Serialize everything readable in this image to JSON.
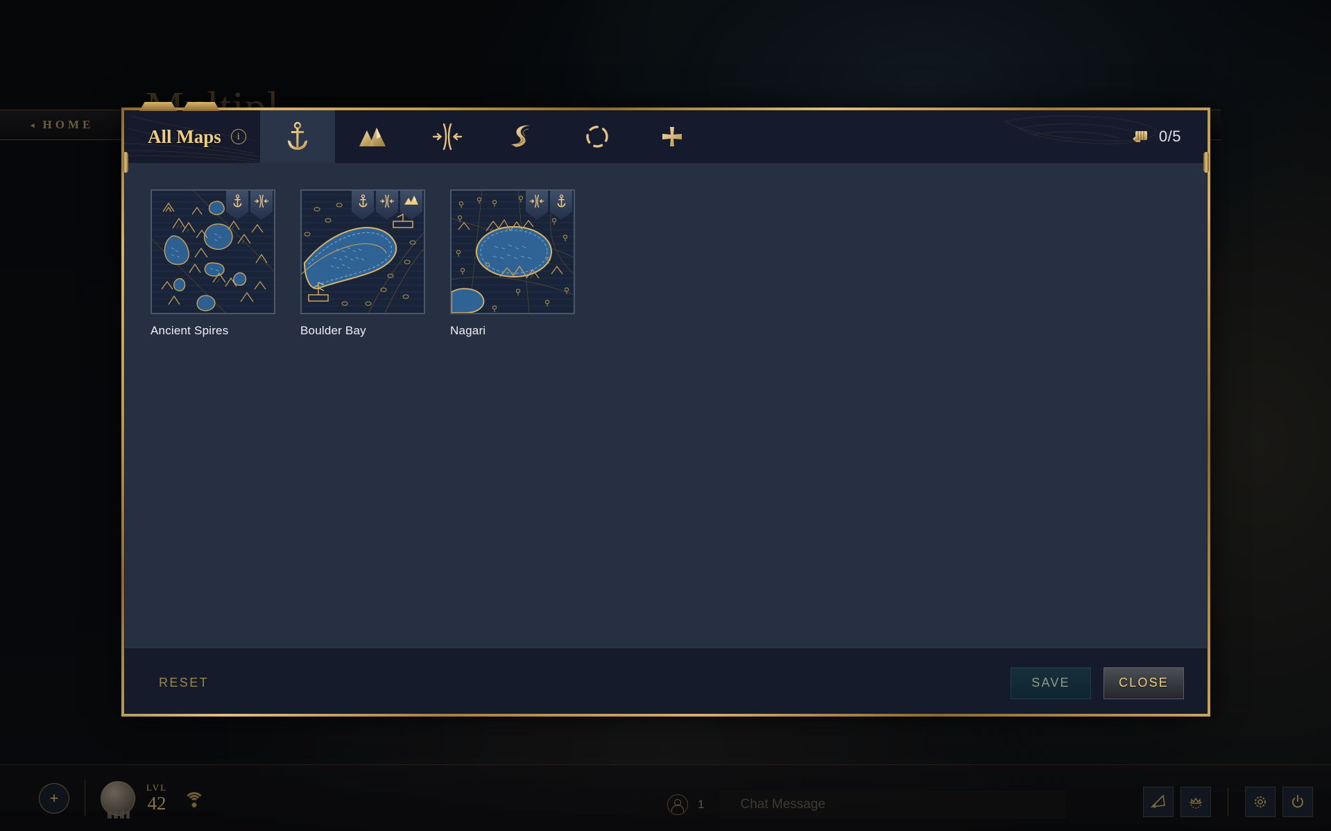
{
  "background": {
    "breadcrumb_home": "HOME",
    "breadcrumb_caret": "◂",
    "page_title": "Multipl"
  },
  "modal": {
    "header": {
      "title": "All Maps",
      "info_icon": "info-icon",
      "counter": {
        "value": "0/5",
        "icon": "fist-icon"
      },
      "tabs": [
        {
          "id": "anchor",
          "icon": "anchor-icon",
          "active": true
        },
        {
          "id": "mountains",
          "icon": "mountains-icon",
          "active": false
        },
        {
          "id": "narrows",
          "icon": "narrows-icon",
          "active": false
        },
        {
          "id": "current",
          "icon": "current-swoosh-icon",
          "active": false
        },
        {
          "id": "ring",
          "icon": "dashed-ring-icon",
          "active": false
        },
        {
          "id": "add",
          "icon": "plus-icon",
          "active": false
        }
      ]
    },
    "maps": [
      {
        "name": "Ancient Spires",
        "badges": [
          "anchor-icon",
          "narrows-icon"
        ]
      },
      {
        "name": "Boulder Bay",
        "badges": [
          "anchor-icon",
          "narrows-icon",
          "mountains-icon"
        ]
      },
      {
        "name": "Nagari",
        "badges": [
          "narrows-icon",
          "anchor-icon"
        ]
      }
    ],
    "footer": {
      "reset_label": "RESET",
      "save_label": "SAVE",
      "close_label": "CLOSE"
    }
  },
  "hud": {
    "add_label": "+",
    "level_label": "LVL",
    "level_value": "42",
    "friends_count": "1",
    "chat_placeholder": "Chat Message",
    "icons": [
      "signal-icon",
      "banner-icon",
      "crown-icon",
      "gear-icon",
      "power-icon"
    ]
  },
  "colors": {
    "gold": "#c9a45c",
    "gold_bright": "#f0cd82",
    "panel": "#273042",
    "header": "#151b2c",
    "footer": "#161b2b",
    "tab_active": "#2b354a"
  }
}
